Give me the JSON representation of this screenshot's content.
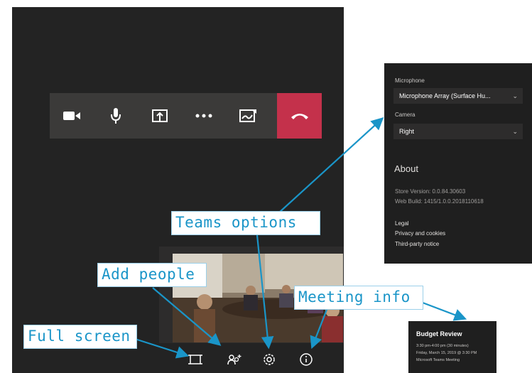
{
  "colors": {
    "window_bg": "#232323",
    "control_bar_bg": "#3b3a39",
    "hangup_red": "#c4314b",
    "callout_blue": "#1a95c8",
    "panel_bg": "#1f1f1f"
  },
  "call_controls": [
    {
      "icon": "camera-icon"
    },
    {
      "icon": "microphone-icon"
    },
    {
      "icon": "share-screen-icon"
    },
    {
      "icon": "more-options-icon"
    },
    {
      "icon": "whiteboard-icon"
    },
    {
      "icon": "hang-up-icon"
    }
  ],
  "bottom_bar": [
    {
      "icon": "full-screen-icon"
    },
    {
      "icon": "add-people-icon"
    },
    {
      "icon": "settings-gear-icon"
    },
    {
      "icon": "info-icon"
    }
  ],
  "settings_panel": {
    "microphone_label": "Microphone",
    "microphone_value": "Microphone Array (Surface Hu...",
    "camera_label": "Camera",
    "camera_value": "Right",
    "about_heading": "About",
    "store_version": "Store Version: 0.0.84.30603",
    "web_build": "Web Build: 1415/1.0.0.2018110618",
    "links": [
      "Legal",
      "Privacy and cookies",
      "Third-party notice"
    ]
  },
  "meeting_card": {
    "title": "Budget Review",
    "lines": [
      "3:30 pm-4:00 pm (30 minutes)",
      "Friday, March 15, 2019 @ 3:30 PM",
      "Microsoft Teams Meeting"
    ]
  },
  "callouts": {
    "teams_options": "Teams options",
    "add_people": "Add people",
    "meeting_info": "Meeting info",
    "full_screen": "Full screen"
  }
}
